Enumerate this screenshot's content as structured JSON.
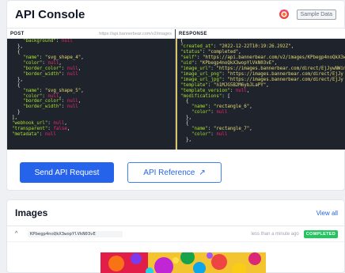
{
  "console": {
    "title": "API Console",
    "sample_data_label": "Sample Data",
    "post": {
      "label": "POST",
      "url": "https://api.bannerbear.com/v2/images",
      "lines": [
        "    \"background\": null",
        "  },",
        "  {",
        "    \"name\": \"svg_shape_4\",",
        "    \"color\": null,",
        "    \"border_color\": null,",
        "    \"border_width\": null",
        "  },",
        "  {",
        "    \"name\": \"svg_shape_5\",",
        "    \"color\": null,",
        "    \"border_color\": null,",
        "    \"border_width\": null",
        "  }",
        "],",
        "\"webhook_url\": null,",
        "\"transparent\": false,",
        "\"metadata\": null"
      ]
    },
    "response": {
      "label": "RESPONSE",
      "lines": [
        "{",
        "\"created_at\": \"2022-12-22T10:19:26.292Z\",",
        "\"status\": \"completed\",",
        "\"self\": \"https://api.bannerbear.com/v2/images/KPbegp4noQkX3w",
        "\"uid\": \"KPbegp4noQkX3wopYlVkN03vE\",",
        "\"image_url\": \"https://images.bannerbear.com/direct/EjJywNWin",
        "\"image_url_png\": \"https://images.bannerbear.com/direct/EjJy",
        "\"image_url_jpg\": \"https://images.bannerbear.com/direct/EjJy",
        "\"template\": \"n1MJG5B2M6ybJLaPY\",",
        "\"template_version\": null,",
        "\"modifications\": [",
        "  {",
        "    \"name\": \"rectangle_6\",",
        "    \"color\": null",
        "  },",
        "  {",
        "    \"name\": \"rectangle_7\",",
        "    \"color\": null",
        "  },"
      ]
    },
    "send_button": "Send API Request",
    "reference_button": "API Reference",
    "reference_icon": "↗"
  },
  "images": {
    "title": "Images",
    "view_all": "View all",
    "row": {
      "chevron": "^",
      "uid": "KPbegp4noQkX3wopYlVkN03vE",
      "timestamp": "less than a minute ago",
      "status": "COMPLETED"
    }
  },
  "colors": {
    "accent": "#2563eb",
    "status_completed": "#22c55e",
    "code_bg": "#1f232c"
  }
}
